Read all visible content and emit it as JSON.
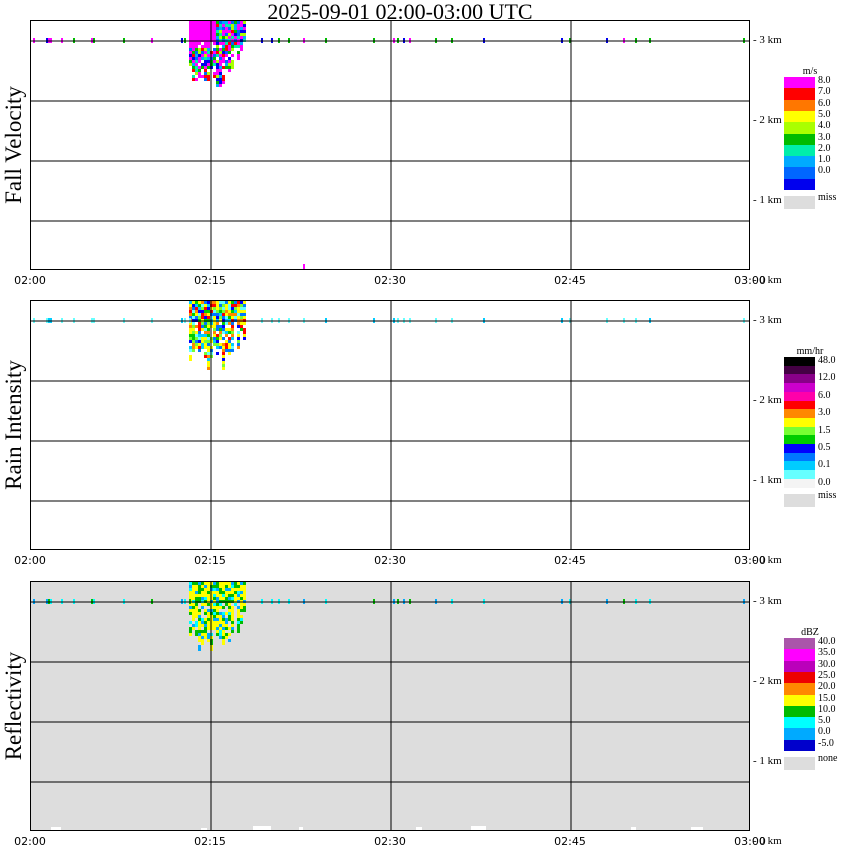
{
  "title": "2025-09-01   02:00-03:00 UTC",
  "x_ticks": [
    "02:00",
    "02:15",
    "02:30",
    "02:45",
    "03:00"
  ],
  "y_ticks": [
    "3 km",
    "2 km",
    "1 km",
    "0 km"
  ],
  "panels": [
    {
      "label": "Fall Velocity",
      "unit": "m/s",
      "colorbar": [
        {
          "color": "#ff00ff",
          "label": "8.0"
        },
        {
          "color": "#ff0000",
          "label": "7.0"
        },
        {
          "color": "#ff7700",
          "label": "6.0"
        },
        {
          "color": "#ffff00",
          "label": "5.0"
        },
        {
          "color": "#aaff00",
          "label": "4.0"
        },
        {
          "color": "#00bb00",
          "label": "3.0"
        },
        {
          "color": "#00eeaa",
          "label": "2.0"
        },
        {
          "color": "#00aaff",
          "label": "1.0"
        },
        {
          "color": "#0066ff",
          "label": "0.0"
        },
        {
          "color": "#0000ee",
          "label": ""
        }
      ],
      "missing_label": "miss",
      "background": "#ffffff"
    },
    {
      "label": "Rain Intensity",
      "unit": "mm/hr",
      "colorbar": [
        {
          "color": "#000000",
          "label": "48.0"
        },
        {
          "color": "#440044",
          "label": ""
        },
        {
          "color": "#880088",
          "label": "12.0"
        },
        {
          "color": "#cc00cc",
          "label": ""
        },
        {
          "color": "#ff00aa",
          "label": "6.0"
        },
        {
          "color": "#ff0000",
          "label": ""
        },
        {
          "color": "#ff8800",
          "label": "3.0"
        },
        {
          "color": "#ffff00",
          "label": ""
        },
        {
          "color": "#77ff33",
          "label": "1.5"
        },
        {
          "color": "#00cc00",
          "label": ""
        },
        {
          "color": "#0000ff",
          "label": "0.5"
        },
        {
          "color": "#0077ff",
          "label": ""
        },
        {
          "color": "#00ccff",
          "label": "0.1"
        },
        {
          "color": "#66ffff",
          "label": ""
        },
        {
          "color": "#f4f4f4",
          "label": "0.0"
        }
      ],
      "missing_label": "miss",
      "background": "#ffffff"
    },
    {
      "label": "Reflectivity",
      "unit": "dBZ",
      "colorbar": [
        {
          "color": "#aa55aa",
          "label": "40.0"
        },
        {
          "color": "#ff00ff",
          "label": "35.0"
        },
        {
          "color": "#bb00bb",
          "label": "30.0"
        },
        {
          "color": "#ee0000",
          "label": "25.0"
        },
        {
          "color": "#ff8800",
          "label": "20.0"
        },
        {
          "color": "#ffff00",
          "label": "15.0"
        },
        {
          "color": "#00bb00",
          "label": "10.0"
        },
        {
          "color": "#00ffff",
          "label": "5.0"
        },
        {
          "color": "#00aaff",
          "label": "0.0"
        },
        {
          "color": "#0000cc",
          "label": "-5.0"
        }
      ],
      "missing_label": "none",
      "background": "#dddddd"
    }
  ],
  "chart_data": [
    {
      "type": "heatmap",
      "ylabel": "Fall Velocity",
      "xlabel": "",
      "x_range": [
        "02:00",
        "03:00"
      ],
      "y_range_km": [
        0,
        3.2
      ],
      "colorbar_unit": "m/s",
      "features": [
        {
          "time_start": "02:13",
          "time_end": "02:18",
          "height_km_min": 2.5,
          "height_km_max": 3.2,
          "values": "mixed 1-8 m/s, mostly 8.0 (magenta) aloft, 0-2 m/s below"
        },
        {
          "time_start": "02:00",
          "time_end": "03:00",
          "height_km_min": 2.98,
          "height_km_max": 3.02,
          "values": "scattered 3.0 (green) near 3 km"
        }
      ]
    },
    {
      "type": "heatmap",
      "ylabel": "Rain Intensity",
      "xlabel": "",
      "x_range": [
        "02:00",
        "03:00"
      ],
      "y_range_km": [
        0,
        3.2
      ],
      "colorbar_unit": "mm/hr",
      "features": [
        {
          "time_start": "02:13",
          "time_end": "02:18",
          "height_km_min": 2.5,
          "height_km_max": 3.2,
          "values": "0.1-6.0 mm/hr, core up to 6.0"
        },
        {
          "time_start": "02:00",
          "time_end": "03:00",
          "height_km_min": 2.98,
          "height_km_max": 3.02,
          "values": "scattered 0.1 near 3 km"
        }
      ]
    },
    {
      "type": "heatmap",
      "ylabel": "Reflectivity",
      "xlabel": "",
      "x_range": [
        "02:00",
        "03:00"
      ],
      "y_range_km": [
        0,
        3.2
      ],
      "colorbar_unit": "dBZ",
      "features": [
        {
          "time_start": "02:13",
          "time_end": "02:18",
          "height_km_min": 2.5,
          "height_km_max": 3.2,
          "values": "5-20 dBZ, core 15-20"
        },
        {
          "time_start": "02:00",
          "time_end": "03:00",
          "height_km_min": 2.98,
          "height_km_max": 3.02,
          "values": "scattered 5-10 dBZ near 3 km"
        }
      ]
    }
  ]
}
